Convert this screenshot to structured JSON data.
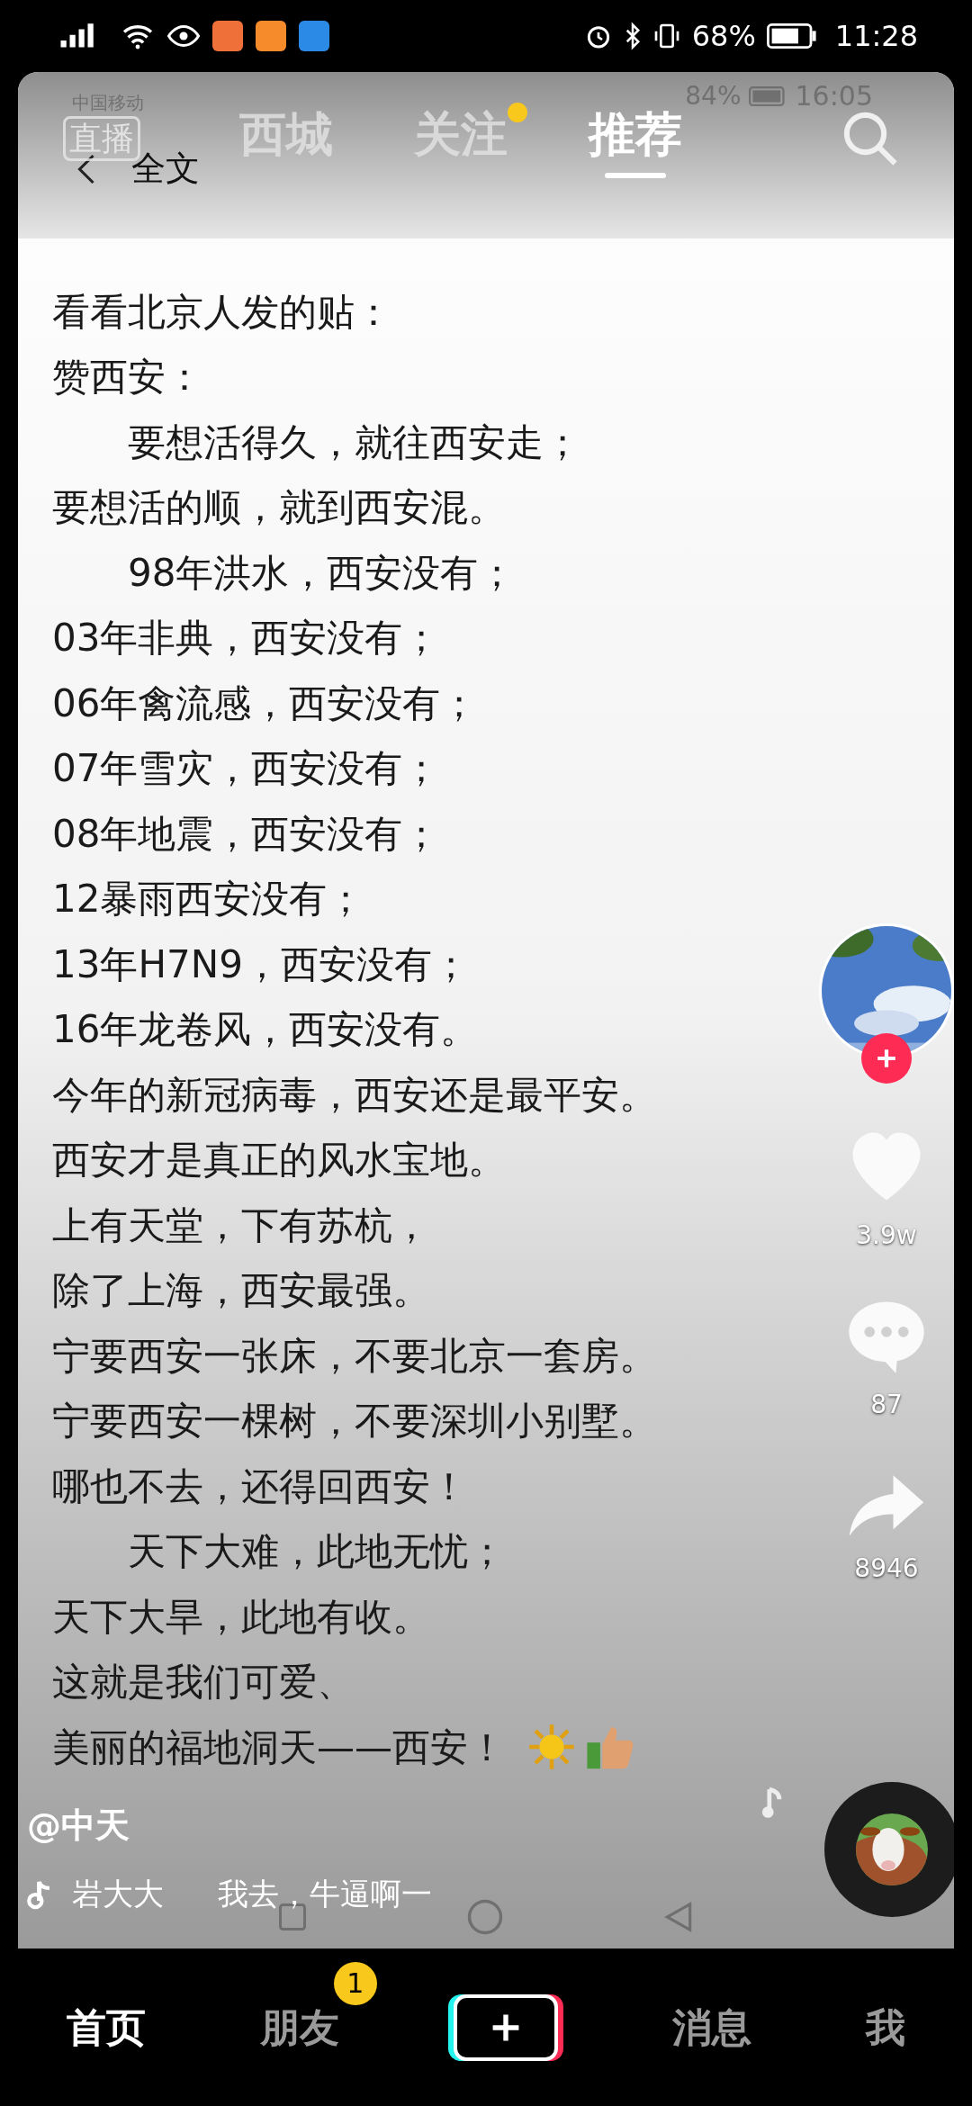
{
  "status_bar": {
    "battery": "68%",
    "time": "11:28"
  },
  "video": {
    "inner_status": {
      "carrier": "中国移动",
      "battery": "84%",
      "time": "16:05"
    },
    "inner_title": "全文",
    "lines": [
      {
        "text": "看看北京人发的贴："
      },
      {
        "text": "赞西安："
      },
      {
        "text": "　　要想活得久，就往西安走；"
      },
      {
        "text": "要想活的顺，就到西安混。"
      },
      {
        "text": "　　98年洪水，西安没有；"
      },
      {
        "text": "03年非典，西安没有；"
      },
      {
        "text": "06年禽流感，西安没有；"
      },
      {
        "text": "07年雪灾，西安没有；"
      },
      {
        "text": "08年地震，西安没有；"
      },
      {
        "text": "12暴雨西安没有；"
      },
      {
        "text": "13年H7N9，西安没有；"
      },
      {
        "text": "16年龙卷风，西安没有。"
      },
      {
        "text": "今年的新冠病毒，西安还是最平安。"
      },
      {
        "text": "西安才是真正的风水宝地。"
      },
      {
        "text": "上有天堂，下有苏杭，"
      },
      {
        "text": "除了上海，西安最强。"
      },
      {
        "text": "宁要西安一张床，不要北京一套房。"
      },
      {
        "text": "宁要西安一棵树，不要深圳小别墅。"
      },
      {
        "text": "哪也不去，还得回西安！"
      },
      {
        "text": "　　天下大难，此地无忧；"
      },
      {
        "text": "天下大旱，此地有收。"
      },
      {
        "text": "这就是我们可爱、"
      },
      {
        "text": "美丽的福地洞天——西安！",
        "emoji": true
      }
    ]
  },
  "top_nav": {
    "live": "直播",
    "tabs": [
      {
        "label": "西城",
        "selected": false,
        "dot": false
      },
      {
        "label": "关注",
        "selected": false,
        "dot": true
      },
      {
        "label": "推荐",
        "selected": true,
        "dot": false
      }
    ]
  },
  "actions": {
    "likes": "3.9w",
    "comments": "87",
    "shares": "8946"
  },
  "author": "@中天",
  "music": {
    "artist": "岩大大",
    "title": "我去，牛逼啊一"
  },
  "bottom_nav": [
    {
      "kind": "tab",
      "label": "首页",
      "selected": true
    },
    {
      "kind": "tab",
      "label": "朋友",
      "selected": false,
      "badge": "1"
    },
    {
      "kind": "create"
    },
    {
      "kind": "tab",
      "label": "消息",
      "selected": false
    },
    {
      "kind": "tab",
      "label": "我",
      "selected": false
    }
  ]
}
